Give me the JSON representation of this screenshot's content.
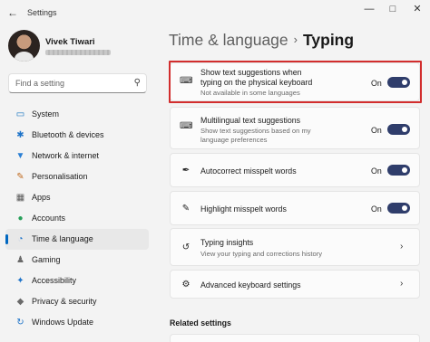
{
  "window": {
    "title": "Settings",
    "back_icon": "back-arrow-icon",
    "minimize": "—",
    "maximize": "□",
    "close": "✕"
  },
  "user": {
    "name": "Vivek Tiwari"
  },
  "search": {
    "placeholder": "Find a setting"
  },
  "sidebar": {
    "items": [
      {
        "label": "System",
        "icon": "▭",
        "color": "#0b6cbd"
      },
      {
        "label": "Bluetooth & devices",
        "icon": "✱",
        "color": "#1f74c9"
      },
      {
        "label": "Network & internet",
        "icon": "▼",
        "color": "#2a7fd4"
      },
      {
        "label": "Personalisation",
        "icon": "✎",
        "color": "#c06a1e"
      },
      {
        "label": "Apps",
        "icon": "▦",
        "color": "#5a5a5a"
      },
      {
        "label": "Accounts",
        "icon": "●",
        "color": "#27a05a"
      },
      {
        "label": "Time & language",
        "icon": "◔",
        "color": "#1f74c9"
      },
      {
        "label": "Gaming",
        "icon": "♟",
        "color": "#6a6a6a"
      },
      {
        "label": "Accessibility",
        "icon": "✦",
        "color": "#1f74c9"
      },
      {
        "label": "Privacy & security",
        "icon": "◆",
        "color": "#6a6a6a"
      },
      {
        "label": "Windows Update",
        "icon": "↻",
        "color": "#1f74c9"
      }
    ]
  },
  "header": {
    "breadcrumb_parent": "Time & language",
    "separator": "›",
    "current": "Typing"
  },
  "settings": {
    "text_suggestions": {
      "title_line1": "Show text suggestions when",
      "title_line2": "typing on the physical keyboard",
      "desc": "Not available in some languages",
      "state": "On"
    },
    "multilingual": {
      "title": "Multilingual text suggestions",
      "desc_line1": "Show text suggestions based on my",
      "desc_line2": "language preferences",
      "state": "On"
    },
    "autocorrect": {
      "title": "Autocorrect misspelt words",
      "state": "On"
    },
    "highlight": {
      "title": "Highlight misspelt words",
      "state": "On"
    },
    "insights": {
      "title": "Typing insights",
      "desc": "View your typing and corrections history"
    },
    "advanced": {
      "title": "Advanced keyboard settings"
    }
  },
  "related": {
    "heading": "Related settings"
  },
  "colors": {
    "accent": "#0067c0",
    "toggle_on": "#2f3d6b",
    "highlight_box": "#d22d2d"
  }
}
